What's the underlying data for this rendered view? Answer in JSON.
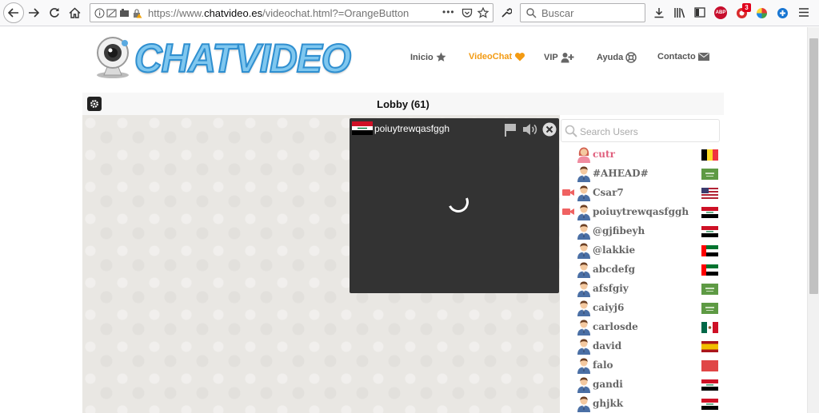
{
  "browser": {
    "url_prefix": "https://www.",
    "url_host": "chatvideo.es",
    "url_path": "/videochat.html?=OrangeButton",
    "search_placeholder": "Buscar",
    "notification_count": "3",
    "abp_label": "ABP"
  },
  "site": {
    "logo_text": "CHATVIDEO",
    "nav": [
      {
        "label": "Inicio",
        "icon": "star-icon"
      },
      {
        "label": "VideoChat",
        "icon": "heart-icon",
        "active": true
      },
      {
        "label": "VIP",
        "icon": "add-user-icon"
      },
      {
        "label": "Ayuda",
        "icon": "lifebuoy-icon"
      },
      {
        "label": "Contacto",
        "icon": "envelope-icon"
      }
    ],
    "accent_color": "#f39b13"
  },
  "lobby": {
    "title": "Lobby (61)"
  },
  "video_window": {
    "username": "poiuytrewqasfggh",
    "flag": "iraq"
  },
  "userlist": {
    "search_placeholder": "Search Users",
    "users": [
      {
        "name": "cutr",
        "gender": "female",
        "camera": false,
        "flag": "belgium"
      },
      {
        "name": "#AHEAD#",
        "gender": "male",
        "camera": false,
        "flag": "saudi-arabia"
      },
      {
        "name": "Csar7",
        "gender": "male",
        "camera": true,
        "flag": "usa"
      },
      {
        "name": "poiuytrewqasfggh",
        "gender": "male",
        "camera": true,
        "flag": "iraq"
      },
      {
        "name": "@gjfibeyh",
        "gender": "male",
        "camera": false,
        "flag": "iraq"
      },
      {
        "name": "@lakkie",
        "gender": "male",
        "camera": false,
        "flag": "uae"
      },
      {
        "name": "abcdefg",
        "gender": "male",
        "camera": false,
        "flag": "uae"
      },
      {
        "name": "afsfgiy",
        "gender": "male",
        "camera": false,
        "flag": "saudi-arabia"
      },
      {
        "name": "caiyj6",
        "gender": "male",
        "camera": false,
        "flag": "saudi-arabia"
      },
      {
        "name": "carlosde",
        "gender": "male",
        "camera": false,
        "flag": "mexico"
      },
      {
        "name": "david",
        "gender": "male",
        "camera": false,
        "flag": "spain"
      },
      {
        "name": "falo",
        "gender": "male",
        "camera": false,
        "flag": "morocco"
      },
      {
        "name": "gandi",
        "gender": "male",
        "camera": false,
        "flag": "iraq"
      },
      {
        "name": "ghjkk",
        "gender": "male",
        "camera": false,
        "flag": "iraq"
      }
    ]
  }
}
